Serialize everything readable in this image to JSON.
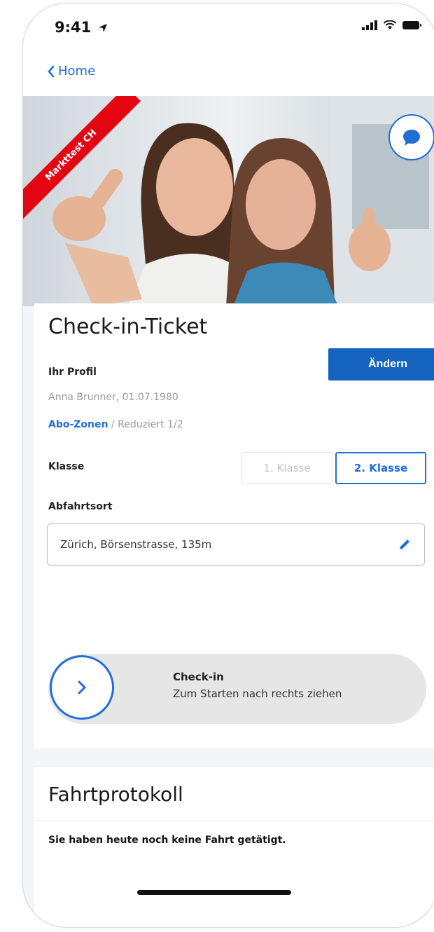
{
  "status_bar": {
    "time": "9:41"
  },
  "nav": {
    "back_label": "Home"
  },
  "hero": {
    "ribbon_label": "Markttest CH"
  },
  "ticket": {
    "title": "Check-in-Ticket",
    "profile_label": "Ihr Profil",
    "profile_name": "Anna Brunner, 01.07.1980",
    "abo_link": "Abo-Zonen",
    "abo_suffix": " / Reduziert 1/2",
    "change_button": "Ändern",
    "klasse_label": "Klasse",
    "klasse_options": [
      "1. Klasse",
      "2. Klasse"
    ],
    "klasse_selected": "2. Klasse",
    "abfahrt_label": "Abfahrtsort",
    "abfahrt_value": "Zürich, Börsenstrasse, 135m",
    "slider_title": "Check-in",
    "slider_subtitle": "Zum Starten nach rechts ziehen"
  },
  "protokoll": {
    "title": "Fahrtprotokoll",
    "empty_text": "Sie haben heute noch keine Fahrt getätigt."
  },
  "icons": {
    "location": "location-arrow-icon",
    "signal": "signal-icon",
    "wifi": "wifi-icon",
    "battery": "battery-icon",
    "back": "chevron-left-icon",
    "chat": "chat-bubble-icon",
    "edit": "pencil-icon",
    "slider": "chevron-right-icon"
  },
  "colors": {
    "accent": "#1f6fd6",
    "primary_button": "#1565c0",
    "ribbon": "#e20613"
  }
}
